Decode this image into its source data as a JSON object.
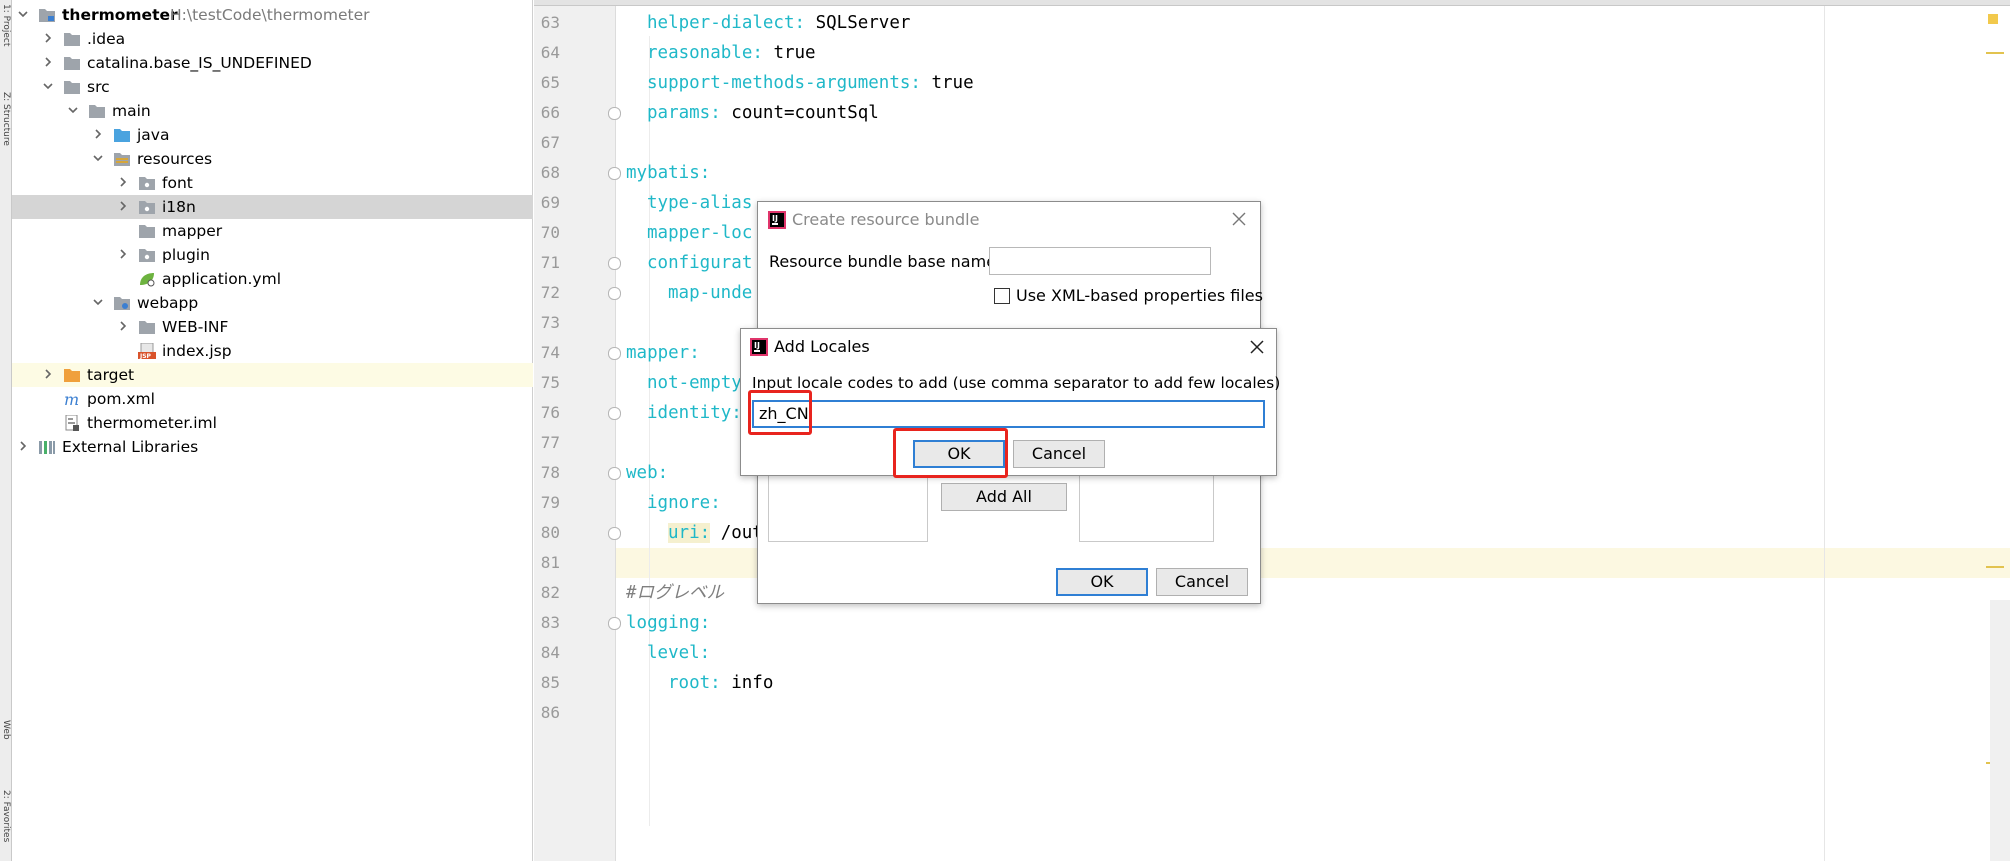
{
  "tool_strip": {
    "project_tab": "1: Project",
    "structure_tab": "Z: Structure",
    "web_tab": "Web",
    "favorites_tab": "2: Favorites"
  },
  "project_tree": {
    "items": [
      {
        "label": "thermometer",
        "path": "H:\\testCode\\thermometer",
        "icon": "module-folder-icon"
      },
      {
        "label": ".idea",
        "icon": "folder-icon"
      },
      {
        "label": "catalina.base_IS_UNDEFINED",
        "icon": "folder-icon"
      },
      {
        "label": "src",
        "icon": "folder-icon"
      },
      {
        "label": "main",
        "icon": "folder-icon"
      },
      {
        "label": "java",
        "icon": "source-folder-icon"
      },
      {
        "label": "resources",
        "icon": "resources-folder-icon"
      },
      {
        "label": "font",
        "icon": "package-folder-icon"
      },
      {
        "label": "i18n",
        "icon": "package-folder-icon"
      },
      {
        "label": "mapper",
        "icon": "folder-icon"
      },
      {
        "label": "plugin",
        "icon": "package-folder-icon"
      },
      {
        "label": "application.yml",
        "icon": "spring-yml-icon"
      },
      {
        "label": "webapp",
        "icon": "web-folder-icon"
      },
      {
        "label": "WEB-INF",
        "icon": "folder-icon"
      },
      {
        "label": "index.jsp",
        "icon": "jsp-file-icon",
        "badge": "JSP"
      },
      {
        "label": "target",
        "icon": "excluded-folder-icon"
      },
      {
        "label": "pom.xml",
        "icon": "maven-icon",
        "glyph": "m"
      },
      {
        "label": "thermometer.iml",
        "icon": "iml-file-icon"
      },
      {
        "label": "External Libraries",
        "icon": "libraries-icon"
      }
    ]
  },
  "editor": {
    "lines": [
      {
        "num": "63",
        "key": "helper-dialect:",
        "val": " SQLServer"
      },
      {
        "num": "64",
        "key": "reasonable:",
        "val": " true"
      },
      {
        "num": "65",
        "key": "support-methods-arguments:",
        "val": " true"
      },
      {
        "num": "66",
        "key": "params:",
        "val": " count=countSql"
      },
      {
        "num": "67",
        "key": "",
        "val": ""
      },
      {
        "num": "68",
        "key": "mybatis:",
        "val": ""
      },
      {
        "num": "69",
        "key": "type-alias",
        "val": ""
      },
      {
        "num": "70",
        "key": "mapper-loc",
        "val": ""
      },
      {
        "num": "71",
        "key": "configurat",
        "val": ""
      },
      {
        "num": "72",
        "key": "map-unde",
        "val": ""
      },
      {
        "num": "73",
        "key": "",
        "val": ""
      },
      {
        "num": "74",
        "key": "mapper:",
        "val": ""
      },
      {
        "num": "75",
        "key": "not-empty",
        "val": ""
      },
      {
        "num": "76",
        "key": "identity:",
        "val": ""
      },
      {
        "num": "77",
        "key": "",
        "val": ""
      },
      {
        "num": "78",
        "key": "web:",
        "val": ""
      },
      {
        "num": "79",
        "key": "ignore:",
        "val": ""
      },
      {
        "num": "80",
        "key": "uri:",
        "val": " /out"
      },
      {
        "num": "81",
        "key": "",
        "val": ""
      },
      {
        "num": "82",
        "key": "",
        "val": "#ログレベル"
      },
      {
        "num": "83",
        "key": "logging:",
        "val": ""
      },
      {
        "num": "84",
        "key": "level:",
        "val": ""
      },
      {
        "num": "85",
        "key": "root:",
        "val": " info"
      },
      {
        "num": "86",
        "key": "",
        "val": ""
      }
    ]
  },
  "create_bundle_dialog": {
    "title": "Create resource bundle",
    "base_name_label": "Resource bundle base name:",
    "base_name_value": "",
    "xml_checkbox_label": "Use XML-based properties files",
    "xml_checked": false,
    "add_all_label": "Add All",
    "ok_label": "OK",
    "cancel_label": "Cancel"
  },
  "add_locales_dialog": {
    "title": "Add Locales",
    "prompt": "Input locale codes to add (use comma separator to add few locales)",
    "input_value": "zh_CN",
    "ok_label": "OK",
    "cancel_label": "Cancel"
  },
  "colors": {
    "key": "#1fb8c8",
    "highlight_red": "#e8241e",
    "focus_blue": "#2f7fd4",
    "selected_row": "#d5d5d5"
  }
}
